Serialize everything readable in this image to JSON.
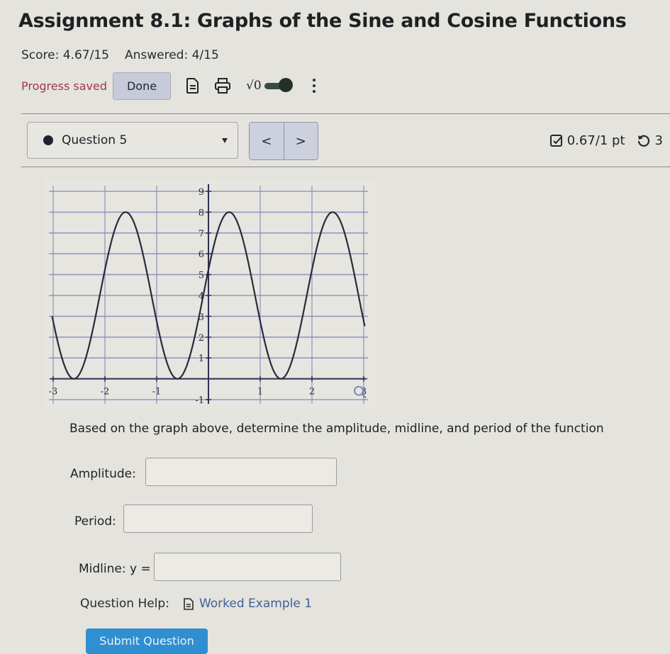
{
  "header": {
    "title": "Assignment 8.1: Graphs of the Sine and Cosine Functions",
    "score": "Score: 4.67/15",
    "answered": "Answered: 4/15"
  },
  "toolbar": {
    "progress_status": "Progress saved",
    "done_label": "Done",
    "icons": [
      "document-icon",
      "print-icon",
      "sqrt-icon",
      "toggle-switch",
      "kebab-menu-icon"
    ],
    "sqrt_label": "√0"
  },
  "question_nav": {
    "selected": "Question 5",
    "prev_label": "<",
    "next_label": ">",
    "points": "0.67/1 pt",
    "retries": "3"
  },
  "question": {
    "prompt": "Based on the graph above, determine the amplitude, midline, and period of the function",
    "fields": [
      {
        "label": "Amplitude:",
        "value": ""
      },
      {
        "label": "Period:",
        "value": ""
      },
      {
        "label": "Midline: y =",
        "value": ""
      }
    ],
    "help_label": "Question Help:",
    "help_link": "Worked Example 1",
    "submit_label": "Submit Question"
  },
  "colors": {
    "progress_saved": "#a3374a",
    "link": "#41609a",
    "submit": "#2f8fd0",
    "grid": "#7f88b5",
    "curve": "#2a2a3a"
  },
  "chart_data": {
    "type": "line",
    "title": "",
    "xlabel": "",
    "ylabel": "",
    "function": "y = 4 + 4 sin(pi (x + 0.1))",
    "amplitude": 4,
    "midline": 4,
    "period": 2,
    "max": 8,
    "min": 0,
    "peaks_x": [
      -1.6,
      0.4,
      2.4
    ],
    "troughs_x": [
      -2.6,
      -0.6,
      1.4
    ],
    "xlim": [
      -3,
      3
    ],
    "ylim": [
      -1,
      9
    ],
    "x_ticks": [
      -3,
      -2,
      -1,
      1,
      2,
      3
    ],
    "y_ticks": [
      -1,
      1,
      2,
      3,
      4,
      5,
      6,
      7,
      8,
      9
    ],
    "grid": true,
    "legend": "none",
    "has_zoom_icon": true
  }
}
